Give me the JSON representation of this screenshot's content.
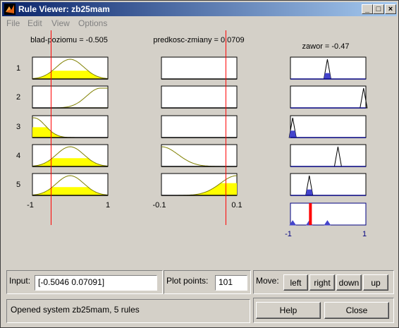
{
  "window": {
    "title": "Rule Viewer: zb25mam",
    "controls": {
      "minimize": "_",
      "maximize": "□",
      "close": "×"
    }
  },
  "menu": [
    "File",
    "Edit",
    "View",
    "Options"
  ],
  "variables": [
    {
      "label": "blad-poziomu = -0.505",
      "range": [
        -1,
        1
      ],
      "tick_labels": [
        "-1",
        "1"
      ],
      "value": -0.505
    },
    {
      "label": "predkosc-zmiany = 0.0709",
      "range": [
        -0.1,
        0.1
      ],
      "tick_labels": [
        "-0.1",
        "0.1"
      ],
      "value": 0.0709
    }
  ],
  "output": {
    "label": "zawor = -0.47",
    "range": [
      -1,
      1
    ],
    "tick_labels": [
      "-1",
      "1"
    ],
    "value": -0.47
  },
  "rule_numbers": [
    "1",
    "2",
    "3",
    "4",
    "5"
  ],
  "input": {
    "label": "Input:",
    "value": "[-0.5046 0.07091]"
  },
  "plot_points": {
    "label": "Plot points:",
    "value": "101"
  },
  "move": {
    "label": "Move:",
    "buttons": [
      "left",
      "right",
      "down",
      "up"
    ]
  },
  "status": "Opened system zb25mam, 5 rules",
  "buttons": {
    "help": "Help",
    "close": "Close"
  },
  "colors": {
    "fill": "#ffff00",
    "curve": "#808000",
    "cursor": "#ff0000",
    "output_tri": "#4444cc",
    "axes_out": "#000080"
  }
}
